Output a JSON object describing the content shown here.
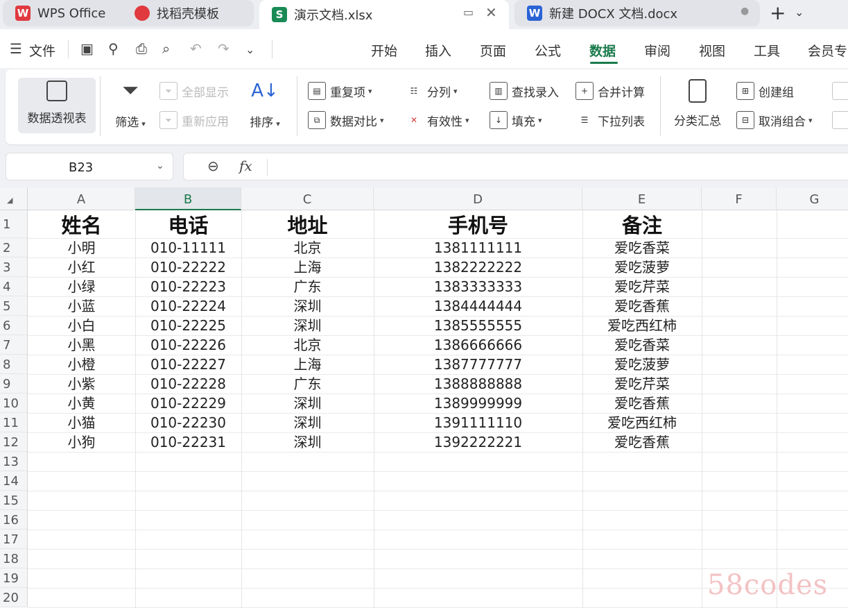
{
  "tabs": [
    {
      "label": "WPS Office",
      "icon": "wps-logo-icon",
      "icon_text": "W",
      "color": "#e0393e"
    },
    {
      "label": "找稻壳模板",
      "icon": "docer-icon",
      "icon_text": "",
      "color": "#e0393e"
    },
    {
      "label": "演示文档.xlsx",
      "icon": "spreadsheet-icon",
      "icon_text": "S",
      "color": "#1a8a55"
    },
    {
      "label": "新建 DOCX 文档.docx",
      "icon": "word-doc-icon",
      "icon_text": "W",
      "color": "#2a63d6"
    }
  ],
  "tab_add": "+",
  "tab_menu": "⌄",
  "file_menu": "文件",
  "menu_items": [
    "开始",
    "插入",
    "页面",
    "公式",
    "数据",
    "审阅",
    "视图",
    "工具",
    "会员专"
  ],
  "active_menu": "数据",
  "accent_color": "#1a7a4c",
  "ribbon": {
    "pivot": "数据透视表",
    "filter": "筛选",
    "show_all": "全部显示",
    "reapply": "重新应用",
    "sort": "排序",
    "duplicates": "重复项",
    "compare": "数据对比",
    "split": "分列",
    "validity": "有效性",
    "lookup_entry": "查找录入",
    "fill": "填充",
    "consolidate": "合并计算",
    "dropdown_list": "下拉列表",
    "subtotal": "分类汇总",
    "create_group": "创建组",
    "ungroup": "取消组合"
  },
  "name_box": "B23",
  "formula_fx": "fx",
  "columns": [
    "A",
    "B",
    "C",
    "D",
    "E",
    "F",
    "G"
  ],
  "selected_column": "B",
  "rows": [
    "1",
    "2",
    "3",
    "4",
    "5",
    "6",
    "7",
    "8",
    "9",
    "10",
    "11",
    "12",
    "13",
    "14",
    "15",
    "16",
    "17",
    "18",
    "19",
    "20"
  ],
  "table_header": [
    "姓名",
    "电话",
    "地址",
    "手机号",
    "备注"
  ],
  "table_rows": [
    [
      "小明",
      "010-11111",
      "北京",
      "1381111111",
      "爱吃香菜"
    ],
    [
      "小红",
      "010-22222",
      "上海",
      "1382222222",
      "爱吃菠萝"
    ],
    [
      "小绿",
      "010-22223",
      "广东",
      "1383333333",
      "爱吃芹菜"
    ],
    [
      "小蓝",
      "010-22224",
      "深圳",
      "1384444444",
      "爱吃香蕉"
    ],
    [
      "小白",
      "010-22225",
      "深圳",
      "1385555555",
      "爱吃西红柿"
    ],
    [
      "小黑",
      "010-22226",
      "北京",
      "1386666666",
      "爱吃香菜"
    ],
    [
      "小橙",
      "010-22227",
      "上海",
      "1387777777",
      "爱吃菠萝"
    ],
    [
      "小紫",
      "010-22228",
      "广东",
      "1388888888",
      "爱吃芹菜"
    ],
    [
      "小黄",
      "010-22229",
      "深圳",
      "1389999999",
      "爱吃香蕉"
    ],
    [
      "小猫",
      "010-22230",
      "深圳",
      "1391111110",
      "爱吃西红柿"
    ],
    [
      "小狗",
      "010-22231",
      "深圳",
      "1392222221",
      "爱吃香蕉"
    ]
  ],
  "watermark": "58codes"
}
